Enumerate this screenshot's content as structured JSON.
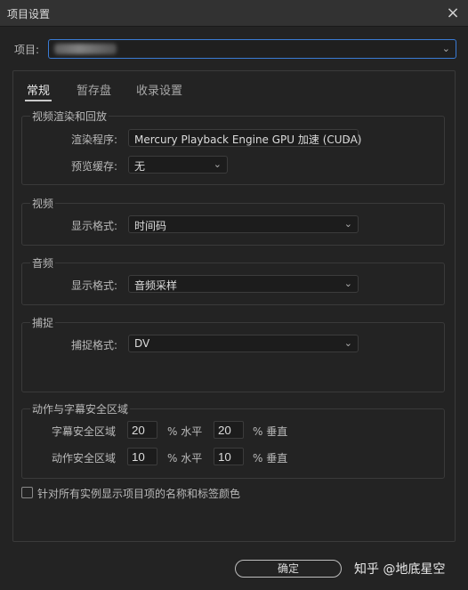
{
  "window": {
    "title": "项目设置",
    "close_icon": "×"
  },
  "project": {
    "label": "项目:",
    "value": ""
  },
  "tabs": [
    {
      "label": "常规"
    },
    {
      "label": "暂存盘"
    },
    {
      "label": "收录设置"
    }
  ],
  "video_render": {
    "title": "视频渲染和回放",
    "renderer_label": "渲染程序:",
    "renderer_value": "Mercury Playback Engine GPU 加速 (CUDA)",
    "preview_cache_label": "预览缓存:",
    "preview_cache_value": "无"
  },
  "video": {
    "title": "视频",
    "display_format_label": "显示格式:",
    "display_format_value": "时间码"
  },
  "audio": {
    "title": "音频",
    "display_format_label": "显示格式:",
    "display_format_value": "音频采样"
  },
  "capture": {
    "title": "捕捉",
    "format_label": "捕捉格式:",
    "format_value": "DV"
  },
  "safe_areas": {
    "title": "动作与字幕安全区域",
    "title_safe_label": "字幕安全区域",
    "title_safe_h": "20",
    "title_safe_v": "20",
    "action_safe_label": "动作安全区域",
    "action_safe_h": "10",
    "action_safe_v": "10",
    "unit_h": "% 水平",
    "unit_v": "% 垂直"
  },
  "checkbox": {
    "label": "针对所有实例显示项目项的名称和标签颜色"
  },
  "ok_label": "确定",
  "watermark": "知乎 @地底星空"
}
